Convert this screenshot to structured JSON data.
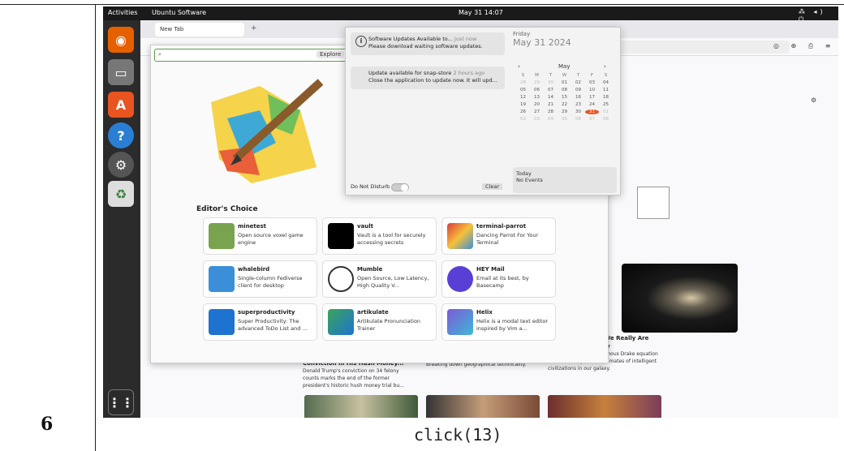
{
  "step_number": "6",
  "caption": "click(13)",
  "topbar": {
    "activities": "Activities",
    "app_name": "Ubuntu Software",
    "clock": "May 31  14:07",
    "system_icons": "⁂ ◂) ⏻"
  },
  "browser": {
    "tab_label": "New Tab",
    "new_tab_symbol": "+"
  },
  "software": {
    "search_placeholder": "",
    "explore_label": "Explore",
    "section_title": "Editor's Choice",
    "apps": [
      {
        "name": "minetest",
        "desc": "Open source voxel game engine",
        "color": "#7aa34f"
      },
      {
        "name": "vault",
        "desc": "Vault is a tool for securely accessing secrets",
        "color": "#000000"
      },
      {
        "name": "terminal-parrot",
        "desc": "Dancing Parrot For Your Terminal",
        "color": "#d93b3b"
      },
      {
        "name": "whalebird",
        "desc": "Single-column Fediverse client for desktop",
        "color": "#3b8fd9"
      },
      {
        "name": "Mumble",
        "desc": "Open Source, Low Latency, High Quality V...",
        "color": "#333333"
      },
      {
        "name": "HEY Mail",
        "desc": "Email at its best, by Basecamp",
        "color": "#5a3fd6"
      },
      {
        "name": "superproductivity",
        "desc": "Super Productivity: The advanced ToDo List and ...",
        "color": "#1e73d0"
      },
      {
        "name": "artikulate",
        "desc": "Artikulate Pronunciation Trainer",
        "color": "#3aa55a"
      },
      {
        "name": "Helix",
        "desc": "Helix is a modal text editor inspired by Vim a...",
        "color": "#7b5ad6"
      }
    ]
  },
  "notifications": [
    {
      "title": "Software Updates Available to...",
      "time": "Just now",
      "body": "Please download waiting software updates."
    },
    {
      "title": "Update available for snap-store",
      "time": "2 hours ago",
      "body": "Close the application to update now. It will upd..."
    }
  ],
  "do_not_disturb_label": "Do Not Disturb",
  "clear_label": "Clear",
  "calendar": {
    "day_label": "Friday",
    "date_label": "May 31 2024",
    "month": "May",
    "prev": "‹",
    "next": "›",
    "weekday_headers": [
      "S",
      "M",
      "T",
      "W",
      "T",
      "F",
      "S"
    ],
    "days": [
      "28",
      "29",
      "30",
      "01",
      "02",
      "03",
      "04",
      "05",
      "06",
      "07",
      "08",
      "09",
      "10",
      "11",
      "12",
      "13",
      "14",
      "15",
      "16",
      "17",
      "18",
      "19",
      "20",
      "21",
      "22",
      "23",
      "24",
      "25",
      "26",
      "27",
      "28",
      "29",
      "30",
      "31",
      "01",
      "02",
      "03",
      "04",
      "05",
      "06",
      "07",
      "08"
    ],
    "today_events_title": "Today",
    "no_events": "No Events"
  },
  "news": [
    {
      "title": "Conviction in His Hush Money...",
      "desc": "Donald Trump's conviction on 34 felony counts marks the end of the former president's historic hush money trial bu..."
    },
    {
      "title": "",
      "desc": "Breaking down geographical technicality."
    },
    {
      "title": "...on Alien ...ests We Really Are Alone in the Galaxy",
      "desc": "An adjustment to the famous Drake equation could radically refine estimates of intelligent civilizations in our galaxy."
    }
  ]
}
